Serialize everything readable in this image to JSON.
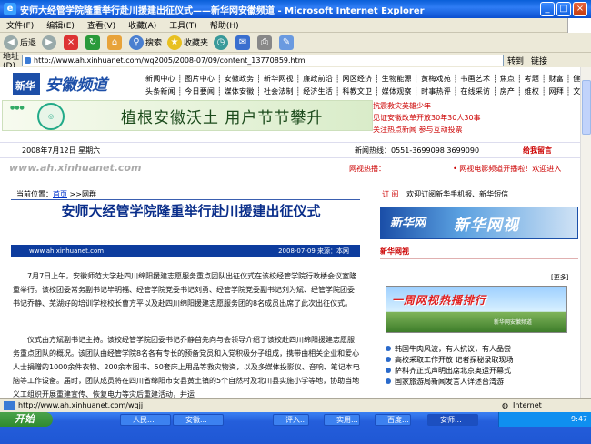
{
  "window": {
    "title": "安师大经管学院隆重举行赴川援建出征仪式——新华网安徽频道 - Microsoft Internet Explorer"
  },
  "menu": [
    "文件(F)",
    "编辑(E)",
    "查看(V)",
    "收藏(A)",
    "工具(T)",
    "帮助(H)"
  ],
  "toolbar": {
    "back": "后退",
    "search": "搜索",
    "favorites": "收藏夹"
  },
  "address": {
    "label": "地址(D)",
    "url": "http://www.ah.xinhuanet.com/wq2005/2008-07/09/content_13770859.htm",
    "go": "转到",
    "links": "链接"
  },
  "page": {
    "nav": [
      "新闻中心 ┊ 图片中心 ┊ 安徽政务 ┊ 新华网视 ┊ 廉政前沿 ┊ 网区经济 ┊ 生物能源 ┊ 黄梅戏苑 ┊ 书画艺术 ┊ 焦点 ┊ 考题 ┊ 财富 ┊ 健康",
      "头条新闻 ┊ 今日要闻 ┊ 媒体安徽 ┊ 社会法制 ┊ 经济生活 ┊ 科教文卫 ┊ 媒体观察 ┊ 时事热评 ┊ 在线采访 ┊ 房产 ┊ 维权 ┊ 网拜 ┊ 文化"
    ],
    "banner_text": "植根安徽沃土 用户节节攀升",
    "side_news": [
      "抗震救灾英雄少年",
      "见证安徽改革开放30年30人30事",
      "关注热点新闻  参与互动投票"
    ],
    "date": "2008年7月12日  星期六",
    "hotline": "新闻热线：0551-3699098    3699090",
    "feedback": "给我留言",
    "site_url": "www.ah.xinhuanet.com",
    "hot_label": "网视热播：",
    "hot_item": "• 网视电影频道开播啦！欢迎进入",
    "breadcrumb_label": "当前位置：",
    "breadcrumb_home": "首页",
    "breadcrumb_sep": " >>网群",
    "article_title": "安师大经管学院隆重举行赴川援建出征仪式",
    "meta_site": "www.ah.xinhuanet.com",
    "meta_date": "2008-07-09   来源：本网",
    "paragraphs": [
      "7月7日上午，安徽师范大学赴四川绵阳援建志愿服务重点团队出征仪式在该校经管学院行政楼会议室隆重举行。该校团委常务副书记毕明福、经管学院党委书记刘勇、经管学院党委副书记刘为斌、经管学院团委书记乔静、芜湖好的培训学校校长曹方平以及赴四川绵阳援建志愿服务团的8名成员出席了此次出征仪式。",
      "仪式由方斌副书记主持。该校经管学院团委书记乔静首先向与会领导介绍了该校赴四川绵阳援建志愿服务重点团队的概况。该团队由经管学院8名各有专长的预备党员和入党积极分子组成，携带由相关企业和爱心人士捐赠的1000余件衣物、200余本图书、50套床上用品等救灾物资，以及多媒体投影仪、音响、笔记本电脑等工作设备。届时，团队成员将在四川省绵阳市安县黄土镇的5个自然村及北川县实施小学等地，协助当地义工组织开展重建宣传、恢复电力等灾后重建活动，并运"
    ],
    "right_links": [
      "订  阅",
      "欢迎订阅新华手机报、新华短信"
    ],
    "xinhua_tv": "新华网视",
    "xinhua_logo": "新华网",
    "panel_title": "新华网视",
    "more": "[更多]",
    "promo_title": "一周网视热播排行",
    "promo_sub": "新华网安徽频道",
    "right_list": [
      "韩国牛肉风波，有人抗议，有人品尝",
      "高校采取工作开放  记者探秘录取现场",
      "萨科齐正式声明出席北京奥运开幕式",
      "国家旅游局新闻发言人详述台湾游"
    ]
  },
  "status": {
    "url": "http://www.ah.xinhuanet.com/wqjj",
    "zone": "Internet"
  },
  "taskbar": {
    "start": "开始",
    "tasks": [
      "人民...",
      "安徽...",
      "评入...",
      "实用...",
      "百度...",
      "安师..."
    ],
    "time": "9:47"
  }
}
